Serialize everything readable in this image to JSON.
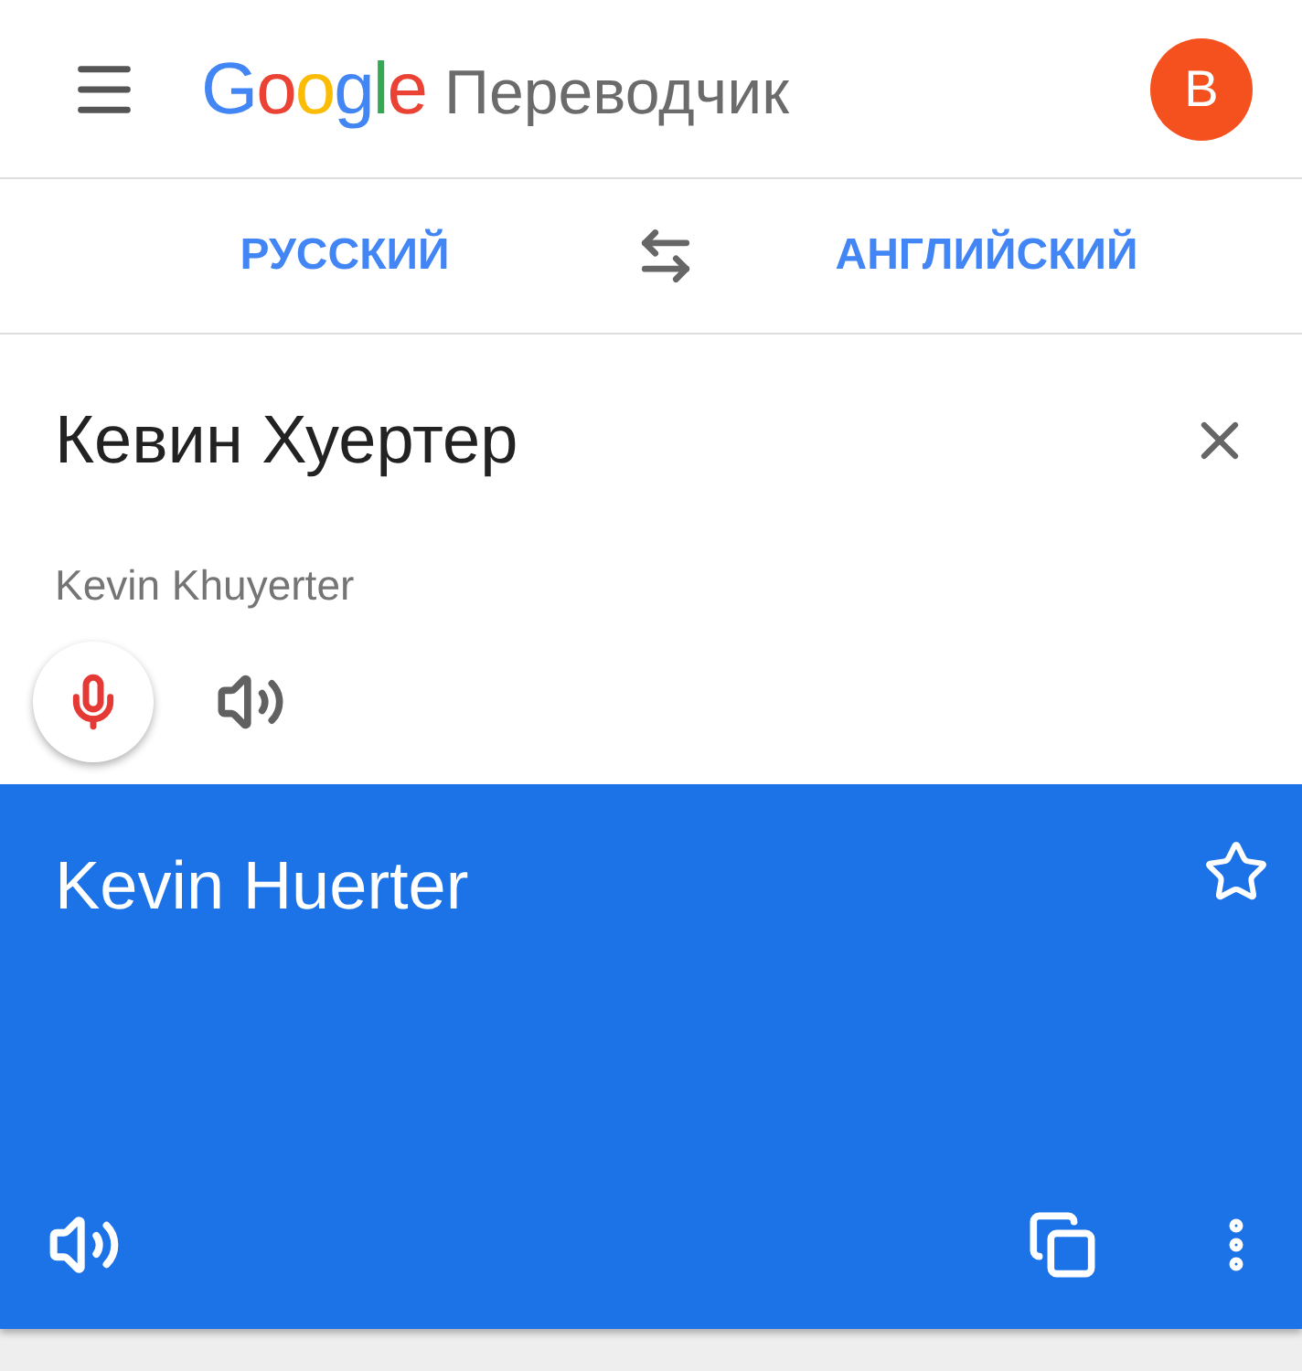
{
  "header": {
    "logo": "Google",
    "title": "Переводчик",
    "avatar": "B"
  },
  "languages": {
    "source": "РУССКИЙ",
    "target": "АНГЛИЙСКИЙ"
  },
  "input": {
    "value": "Кевин Хуертер",
    "transliteration": "Kevin Khuyerter"
  },
  "result": {
    "text": "Kevin Huerter",
    "starred": false
  }
}
